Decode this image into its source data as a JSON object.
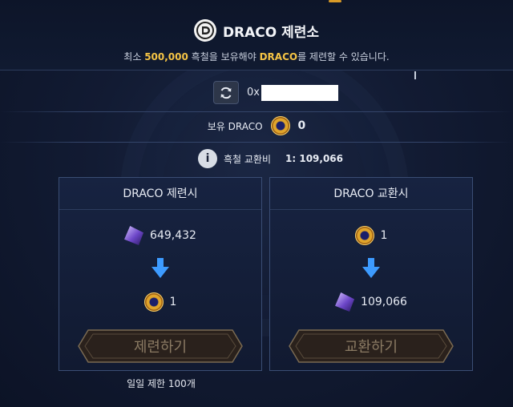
{
  "header": {
    "title": "DRACO 제련소",
    "subtitle_prefix": "최소 ",
    "subtitle_amount": "500,000",
    "subtitle_mid": " 흑철을 보유해야 ",
    "subtitle_token": "DRACO",
    "subtitle_suffix": "를 제련할 수 있습니다."
  },
  "wallet": {
    "address_prefix": "0x"
  },
  "holding": {
    "label": "보유 DRACO",
    "value": "0"
  },
  "exchange_rate": {
    "label": "흑철 교환비",
    "value": "1: 109,066"
  },
  "refine_panel": {
    "title": "DRACO 제련시",
    "input_amount": "649,432",
    "output_amount": "1",
    "button_label": "제련하기",
    "daily_limit": "일일 제한 100개"
  },
  "exchange_panel": {
    "title": "DRACO 교환시",
    "input_amount": "1",
    "output_amount": "109,066",
    "button_label": "교환하기"
  },
  "colors": {
    "accent_gold": "#f5c445",
    "background": "#121b33",
    "panel_border": "#3a4d74",
    "arrow_blue": "#3d9bff"
  }
}
